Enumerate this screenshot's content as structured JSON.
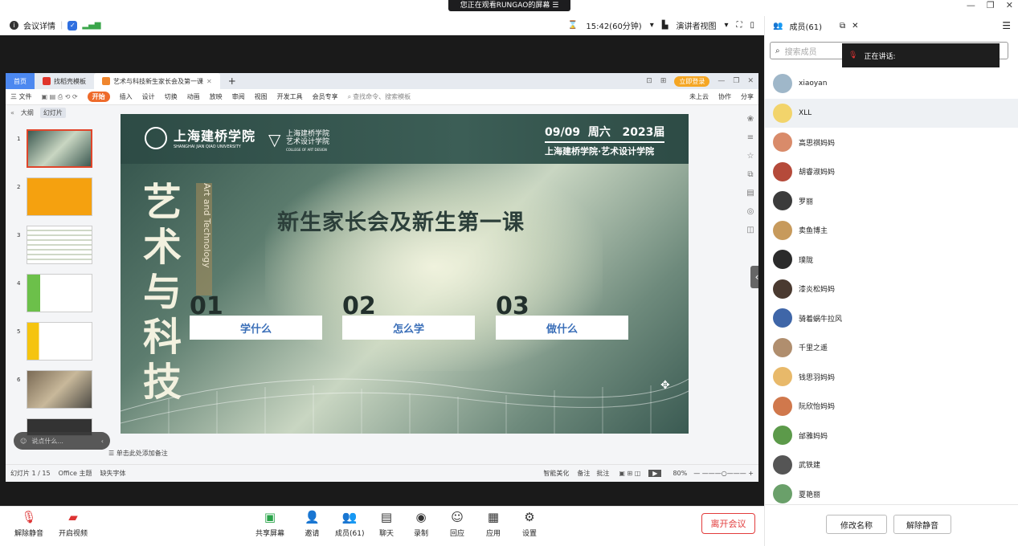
{
  "banner": {
    "text": "您正在观看RUNGAO的屏幕 ☰"
  },
  "window_controls": [
    "—",
    "❐",
    "✕"
  ],
  "topbar": {
    "meeting_details": "会议详情",
    "timer": "15:42(60分钟)",
    "presenter_view": "演讲者视图"
  },
  "wps": {
    "tabs": [
      {
        "label": "首页"
      },
      {
        "label": "找稻壳模板"
      },
      {
        "label": "艺术与科技新生家长会及第一课"
      }
    ],
    "login_badge": "立即登录",
    "menu": [
      "三 文件",
      "开始",
      "插入",
      "设计",
      "切换",
      "动画",
      "放映",
      "审阅",
      "视图",
      "开发工具",
      "会员专享"
    ],
    "search_cmd": "查找命令、搜索模板",
    "cloud": "未上云",
    "collab": "协作",
    "share": "分享",
    "left_tabs": [
      "大纲",
      "幻灯片"
    ],
    "thumb_numbers": [
      "1",
      "2",
      "3",
      "4",
      "5",
      "6"
    ],
    "notes_hint": "单击此处添加备注",
    "status": {
      "slide_count": "幻灯片 1 / 15",
      "theme": "Office 主题",
      "missing_font": "缺失字体",
      "beautify": "智能美化",
      "notes": "备注",
      "comments": "批注",
      "zoom": "80%"
    }
  },
  "slide": {
    "school_cn": "上海建桥学院",
    "school_en": "SHANGHAI JIAN QIAO UNIVERSITY",
    "college_cn": "上海建桥学院\n艺术设计学院",
    "college_en": "COLLEGE OF ART DESIGN",
    "date": "09/09  周六   2023届",
    "org": "上海建桥学院·艺术设计学院",
    "big_vertical": "艺术与科技",
    "en_vertical": "Art and Technology",
    "title": "新生家长会及新生第一课",
    "items": [
      {
        "num": "01",
        "label": "学什么"
      },
      {
        "num": "02",
        "label": "怎么学"
      },
      {
        "num": "03",
        "label": "做什么"
      }
    ]
  },
  "chat_float": {
    "placeholder": "说点什么..."
  },
  "bottombar": {
    "unmute": "解除静音",
    "start_video": "开启视频",
    "share_screen": "共享屏幕",
    "invite": "邀请",
    "members": "成员(61)",
    "chat": "聊天",
    "record": "录制",
    "reactions": "回应",
    "apps": "应用",
    "settings": "设置",
    "leave": "离开会议"
  },
  "members_panel": {
    "title": "成员(61)",
    "search_placeholder": "搜索成员",
    "speaking": "正在讲话:",
    "list": [
      {
        "name": "xiaoyan",
        "color": "#9fb7c9"
      },
      {
        "name": "XLL",
        "color": "#f2d46b"
      },
      {
        "name": "高思祺妈妈",
        "color": "#d98b6a"
      },
      {
        "name": "胡睿淑妈妈",
        "color": "#b54a3a"
      },
      {
        "name": "罗丽",
        "color": "#3b3b3b"
      },
      {
        "name": "卖鱼博主",
        "color": "#c79a5c"
      },
      {
        "name": "璞陇",
        "color": "#2b2b2b"
      },
      {
        "name": "漆炎松妈妈",
        "color": "#4a3a30"
      },
      {
        "name": "骑着蜗牛拉风",
        "color": "#3f66a8"
      },
      {
        "name": "千里之遥",
        "color": "#b08e6e"
      },
      {
        "name": "钱思羽妈妈",
        "color": "#e8b96a"
      },
      {
        "name": "阮欣怡妈妈",
        "color": "#d0784c"
      },
      {
        "name": "邰雅妈妈",
        "color": "#5c9a4a"
      },
      {
        "name": "武铁建",
        "color": "#555555"
      },
      {
        "name": "夏艳丽",
        "color": "#6aa06a"
      }
    ],
    "rename": "修改名称",
    "unmute": "解除静音"
  }
}
